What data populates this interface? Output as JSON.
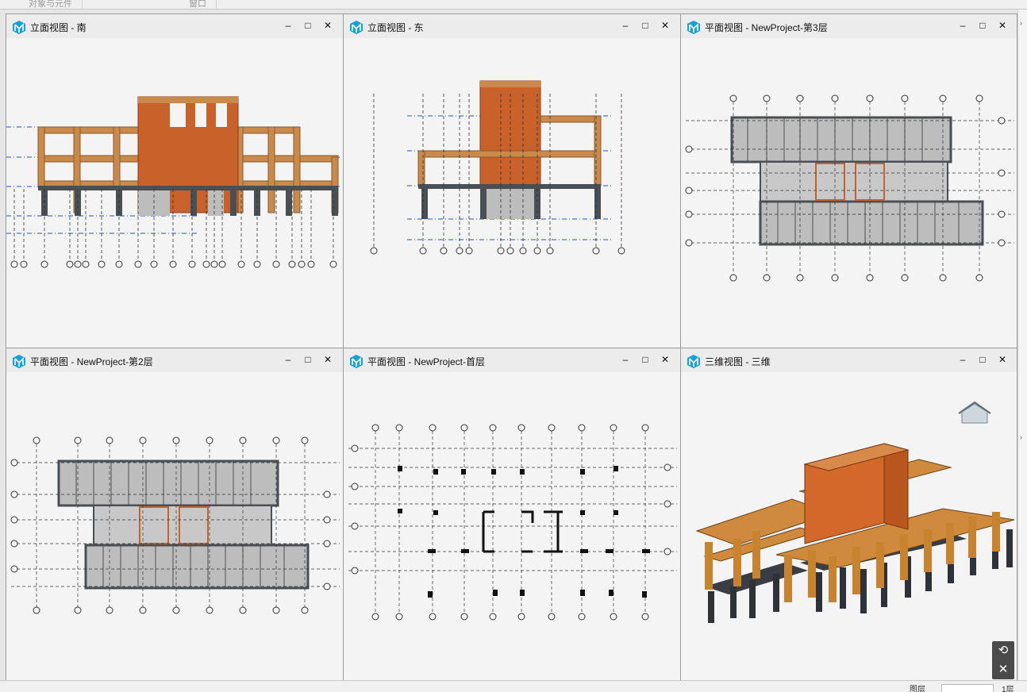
{
  "topbar": {
    "tabs": [
      "对象与元件",
      "窗口"
    ]
  },
  "panes": [
    {
      "title": "立面视图 - 南"
    },
    {
      "title": "立面视图 - 东"
    },
    {
      "title": "平面视图 - NewProject-第3层"
    },
    {
      "title": "平面视图 - NewProject-第2层"
    },
    {
      "title": "平面视图 - NewProject-首层"
    },
    {
      "title": "三维视图 - 三维"
    }
  ],
  "window_controls": {
    "minimize": "–",
    "maximize": "□",
    "close": "✕"
  },
  "icons": {
    "app": "cube-logo-icon",
    "viewcube": "house-icon",
    "reset": "rotate-icon",
    "close_nav": "close-icon"
  },
  "bottombar": {
    "label": "图层",
    "label2": "1层"
  },
  "colors": {
    "wood": "#c98a4b",
    "brick": "#c8622a",
    "column": "#4a4f55",
    "slab": "#bdbdbd",
    "grid": "#333333",
    "level": "#2255cc"
  }
}
